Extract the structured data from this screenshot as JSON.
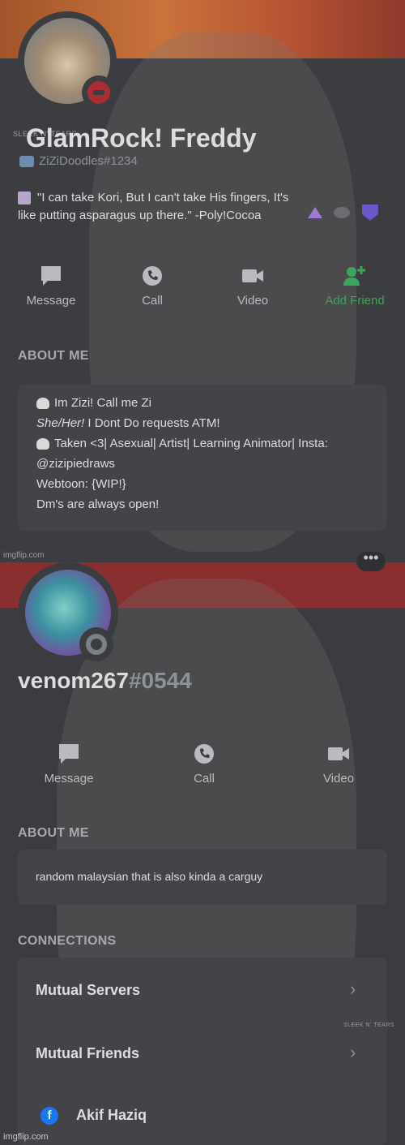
{
  "profile1": {
    "sticker_text": "SLEEK N' TEARS",
    "display_name": "GlamRock! Freddy",
    "username": "ZiZiDoodles#1234",
    "custom_status": "\"I can take Kori, But I can't take His fingers, It's like putting asparagus up there.\" -Poly!Cocoa",
    "actions": {
      "message": "Message",
      "call": "Call",
      "video": "Video",
      "add_friend": "Add Friend"
    },
    "about_title": "ABOUT ME",
    "about_lines": {
      "l1": "Im Zizi! Call me Zi",
      "l2a": "She/Her!",
      "l2b": " I Dont Do requests ATM!",
      "l3": "Taken <3| Asexual| Artist| Learning Animator| Insta:",
      "l4": "@zizipiedraws",
      "l5": "Webtoon: {WIP!}",
      "l6": "Dm's are always open!"
    },
    "watermark": "imgflip.com",
    "colors": {
      "add_friend": "#3ba55c",
      "dnd_status": "#a82e31"
    }
  },
  "profile2": {
    "more_label": "•••",
    "display_name": "venom267",
    "discriminator": "#0544",
    "actions": {
      "message": "Message",
      "call": "Call",
      "video": "Video"
    },
    "about_title": "ABOUT ME",
    "about_text": "random malaysian that is also kinda a carguy",
    "connections_title": "CONNECTIONS",
    "rows": {
      "mutual_servers": "Mutual Servers",
      "mutual_friends": "Mutual Friends",
      "facebook": "Akif Haziq"
    },
    "sticker_text": "SLEEK N' TEARS",
    "watermark": "imgflip.com"
  }
}
